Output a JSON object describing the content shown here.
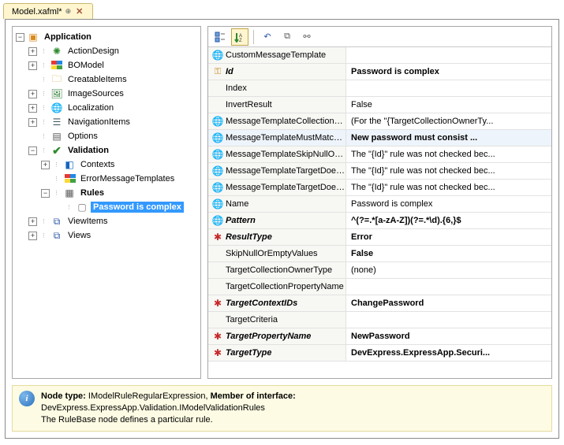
{
  "tab": {
    "title": "Model.xafml*"
  },
  "tree": {
    "root": "Application",
    "items": [
      "ActionDesign",
      "BOModel",
      "CreatableItems",
      "ImageSources",
      "Localization",
      "NavigationItems",
      "Options",
      "Validation",
      "Contexts",
      "ErrorMessageTemplates",
      "Rules",
      "Password is complex",
      "ViewItems",
      "Views"
    ]
  },
  "props": [
    {
      "icon": "globe",
      "name": "CustomMessageTemplate",
      "value": "",
      "bold": false,
      "vbold": false
    },
    {
      "icon": "key",
      "name": "Id",
      "value": "Password is complex",
      "bold": true,
      "vbold": true
    },
    {
      "icon": "",
      "name": "Index",
      "value": "",
      "bold": false,
      "vbold": false
    },
    {
      "icon": "",
      "name": "InvertResult",
      "value": "False",
      "bold": false,
      "vbold": false
    },
    {
      "icon": "globe",
      "name": "MessageTemplateCollectionValida",
      "value": "(For the \"{TargetCollectionOwnerTy...",
      "bold": false,
      "vbold": false
    },
    {
      "icon": "globe",
      "name": "MessageTemplateMustMatchPatt",
      "value": "New password must consist ...",
      "bold": false,
      "vbold": true,
      "sel": true
    },
    {
      "icon": "globe",
      "name": "MessageTemplateSkipNullOrEmpt",
      "value": "The \"{Id}\" rule was not checked bec...",
      "bold": false,
      "vbold": false
    },
    {
      "icon": "globe",
      "name": "MessageTemplateTargetDoesNot",
      "value": "The \"{Id}\" rule was not checked bec...",
      "bold": false,
      "vbold": false
    },
    {
      "icon": "globe",
      "name": "MessageTemplateTargetDoesNot",
      "value": "The \"{Id}\" rule was not checked bec...",
      "bold": false,
      "vbold": false
    },
    {
      "icon": "globe",
      "name": "Name",
      "value": "Password is complex",
      "bold": false,
      "vbold": false
    },
    {
      "icon": "globe",
      "name": "Pattern",
      "value": "^(?=.*[a-zA-Z])(?=.*\\d).{6,}$",
      "bold": true,
      "vbold": true
    },
    {
      "icon": "star",
      "name": "ResultType",
      "value": "Error",
      "bold": true,
      "vbold": true
    },
    {
      "icon": "",
      "name": "SkipNullOrEmptyValues",
      "value": "False",
      "bold": false,
      "vbold": true
    },
    {
      "icon": "",
      "name": "TargetCollectionOwnerType",
      "value": "(none)",
      "bold": false,
      "vbold": false
    },
    {
      "icon": "",
      "name": "TargetCollectionPropertyName",
      "value": "",
      "bold": false,
      "vbold": false
    },
    {
      "icon": "star",
      "name": "TargetContextIDs",
      "value": "ChangePassword",
      "bold": true,
      "vbold": true
    },
    {
      "icon": "",
      "name": "TargetCriteria",
      "value": "",
      "bold": false,
      "vbold": false
    },
    {
      "icon": "star",
      "name": "TargetPropertyName",
      "value": "NewPassword",
      "bold": true,
      "vbold": true
    },
    {
      "icon": "star",
      "name": "TargetType",
      "value": "DevExpress.ExpressApp.Securi...",
      "bold": true,
      "vbold": true
    }
  ],
  "info": {
    "l1a": "Node type: ",
    "l1b": "IModelRuleRegularExpression, ",
    "l1c": "Member of interface:",
    "l2": "DevExpress.ExpressApp.Validation.IModelValidationRules",
    "l3": "The RuleBase node defines a particular rule."
  }
}
